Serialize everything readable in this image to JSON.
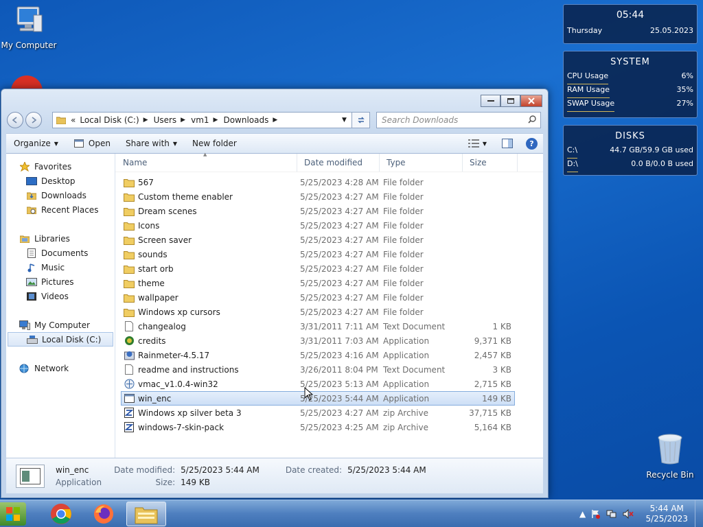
{
  "desktop": {
    "my_computer_label": "My Computer",
    "recycle_bin_label": "Recycle Bin"
  },
  "widgets": {
    "clock": {
      "time": "05:44",
      "day": "Thursday",
      "date": "25.05.2023"
    },
    "system": {
      "title": "SYSTEM",
      "rows": [
        {
          "label": "CPU Usage",
          "value": "6%"
        },
        {
          "label": "RAM Usage",
          "value": "35%"
        },
        {
          "label": "SWAP Usage",
          "value": "27%"
        }
      ]
    },
    "disks": {
      "title": "DISKS",
      "rows": [
        {
          "label": "C:\\",
          "value": "44.7 GB/59.9 GB used"
        },
        {
          "label": "D:\\",
          "value": "0.0 B/0.0 B used"
        }
      ]
    }
  },
  "explorer": {
    "address": {
      "overflow": "«",
      "crumbs": [
        "Local Disk (C:)",
        "Users",
        "vm1",
        "Downloads"
      ]
    },
    "search_placeholder": "Search Downloads",
    "toolbar": {
      "organize": "Organize",
      "open": "Open",
      "share_with": "Share with",
      "new_folder": "New folder"
    },
    "nav": {
      "favorites": "Favorites",
      "desktop": "Desktop",
      "downloads": "Downloads",
      "recent_places": "Recent Places",
      "libraries": "Libraries",
      "documents": "Documents",
      "music": "Music",
      "pictures": "Pictures",
      "videos": "Videos",
      "my_computer": "My Computer",
      "local_disk": "Local Disk (C:)",
      "network": "Network"
    },
    "columns": {
      "name": "Name",
      "date": "Date modified",
      "type": "Type",
      "size": "Size"
    },
    "files": [
      {
        "name": "567",
        "date": "5/25/2023 4:28 AM",
        "type": "File folder",
        "size": "",
        "icon": "folder-icon"
      },
      {
        "name": "Custom theme enabler",
        "date": "5/25/2023 4:27 AM",
        "type": "File folder",
        "size": "",
        "icon": "folder-icon"
      },
      {
        "name": "Dream scenes",
        "date": "5/25/2023 4:27 AM",
        "type": "File folder",
        "size": "",
        "icon": "folder-icon"
      },
      {
        "name": "Icons",
        "date": "5/25/2023 4:27 AM",
        "type": "File folder",
        "size": "",
        "icon": "folder-icon"
      },
      {
        "name": "Screen saver",
        "date": "5/25/2023 4:27 AM",
        "type": "File folder",
        "size": "",
        "icon": "folder-icon"
      },
      {
        "name": "sounds",
        "date": "5/25/2023 4:27 AM",
        "type": "File folder",
        "size": "",
        "icon": "folder-icon"
      },
      {
        "name": "start orb",
        "date": "5/25/2023 4:27 AM",
        "type": "File folder",
        "size": "",
        "icon": "folder-icon"
      },
      {
        "name": "theme",
        "date": "5/25/2023 4:27 AM",
        "type": "File folder",
        "size": "",
        "icon": "folder-icon"
      },
      {
        "name": "wallpaper",
        "date": "5/25/2023 4:27 AM",
        "type": "File folder",
        "size": "",
        "icon": "folder-icon"
      },
      {
        "name": "Windows xp cursors",
        "date": "5/25/2023 4:27 AM",
        "type": "File folder",
        "size": "",
        "icon": "folder-icon"
      },
      {
        "name": "changealog",
        "date": "3/31/2011 7:11 AM",
        "type": "Text Document",
        "size": "1 KB",
        "icon": "text-document-icon"
      },
      {
        "name": "credits",
        "date": "3/31/2011 7:03 AM",
        "type": "Application",
        "size": "9,371 KB",
        "icon": "gear-app-icon"
      },
      {
        "name": "Rainmeter-4.5.17",
        "date": "5/25/2023 4:16 AM",
        "type": "Application",
        "size": "2,457 KB",
        "icon": "installer-icon"
      },
      {
        "name": "readme and instructions",
        "date": "3/26/2011 8:04 PM",
        "type": "Text Document",
        "size": "3 KB",
        "icon": "text-document-icon"
      },
      {
        "name": "vmac_v1.0.4-win32",
        "date": "5/25/2023 5:13 AM",
        "type": "Application",
        "size": "2,715 KB",
        "icon": "globe-app-icon"
      },
      {
        "name": "win_enc",
        "date": "5/25/2023 5:44 AM",
        "type": "Application",
        "size": "149 KB",
        "icon": "window-app-icon",
        "selected": true
      },
      {
        "name": "Windows xp silver beta 3",
        "date": "5/25/2023 4:27 AM",
        "type": "zip Archive",
        "size": "37,715 KB",
        "icon": "zip-archive-icon"
      },
      {
        "name": "windows-7-skin-pack",
        "date": "5/25/2023 4:25 AM",
        "type": "zip Archive",
        "size": "5,164 KB",
        "icon": "zip-archive-icon"
      }
    ],
    "details": {
      "name": "win_enc",
      "kind": "Application",
      "date_modified_label": "Date modified:",
      "date_modified": "5/25/2023 5:44 AM",
      "size_label": "Size:",
      "size": "149 KB",
      "date_created_label": "Date created:",
      "date_created": "5/25/2023 5:44 AM"
    }
  },
  "taskbar": {
    "apps": [
      "chrome-icon",
      "firefox-icon",
      "explorer-folder-icon"
    ],
    "clock_time": "5:44 AM",
    "clock_date": "5/25/2023"
  },
  "colors": {
    "desktop_blue": "#0e58b8",
    "selection": "#cddff6",
    "widget_bg": "#081e46",
    "widget_underline": "#d4b85a"
  }
}
